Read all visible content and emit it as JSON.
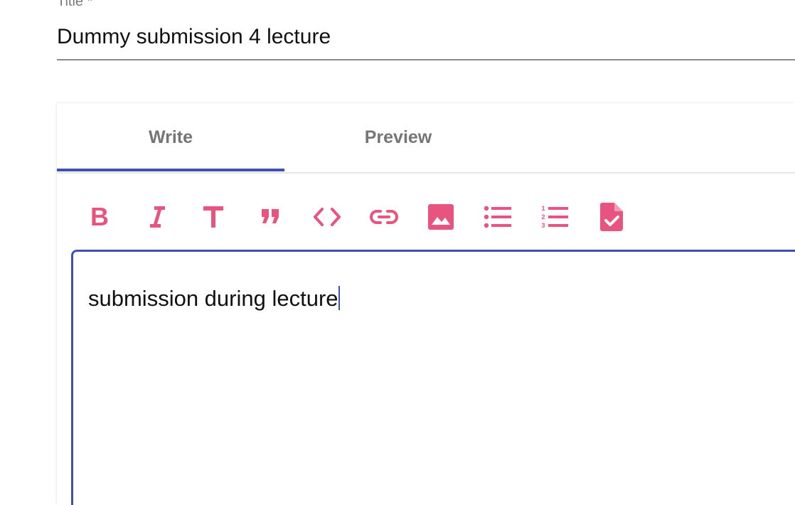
{
  "title_field": {
    "label": "Title *",
    "value": "Dummy submission 4 lecture"
  },
  "editor": {
    "tabs": [
      {
        "label": "Write",
        "active": true
      },
      {
        "label": "Preview",
        "active": false
      }
    ],
    "toolbar": [
      {
        "icon": "bold-icon",
        "title": "Bold"
      },
      {
        "icon": "italic-icon",
        "title": "Italic"
      },
      {
        "icon": "header-icon",
        "title": "Header"
      },
      {
        "icon": "quote-icon",
        "title": "Quote"
      },
      {
        "icon": "code-icon",
        "title": "Code"
      },
      {
        "icon": "link-icon",
        "title": "Link"
      },
      {
        "icon": "image-icon",
        "title": "Image"
      },
      {
        "icon": "bulleted-list-icon",
        "title": "Bulleted list"
      },
      {
        "icon": "numbered-list-icon",
        "title": "Numbered list"
      },
      {
        "icon": "checked-file-icon",
        "title": "Checked list"
      }
    ],
    "content": "submission during lecture"
  },
  "colors": {
    "accent": "#3f51b5",
    "icon": "#e8537f",
    "tab_text": "#757575",
    "label": "#7a7a7a"
  }
}
